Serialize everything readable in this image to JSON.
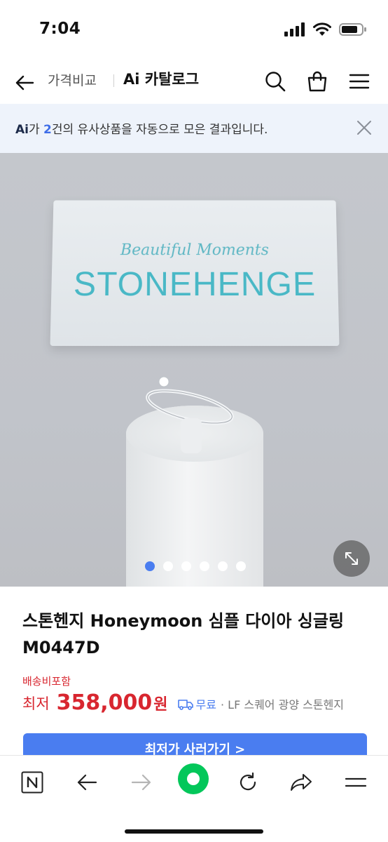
{
  "status_bar": {
    "time": "7:04"
  },
  "header": {
    "back_icon": "arrow-left-icon",
    "subtitle": "가격비교",
    "title": "Ai 카탈로그",
    "actions": [
      "search-icon",
      "shopping-bag-icon",
      "menu-icon"
    ]
  },
  "ai_banner": {
    "ai_mark": "Ai",
    "text_1": "가 ",
    "count": "2",
    "text_2": "건의 유사상품을 자동으로 모은 결과입니다."
  },
  "product_image": {
    "sign_tagline": "Beautiful Moments",
    "sign_brand": "STONEHENGE",
    "slide_count": 6,
    "active_slide": 1
  },
  "product": {
    "title": "스톤헨지 Honeymoon 심플 다이아 싱글링 M0447D",
    "shipping_label": "배송비포함",
    "price_prefix": "최저",
    "price": "358,000",
    "price_unit": "원",
    "shipping_free": "무료",
    "seller": "· LF 스퀘어 광양 스톤헨지",
    "buy_label": "최저가 사러가기 >"
  },
  "colors": {
    "accent": "#4a7df0",
    "price_red": "#d8262f",
    "banner_bg": "#eef3fb",
    "naver_green": "#03c75a"
  }
}
